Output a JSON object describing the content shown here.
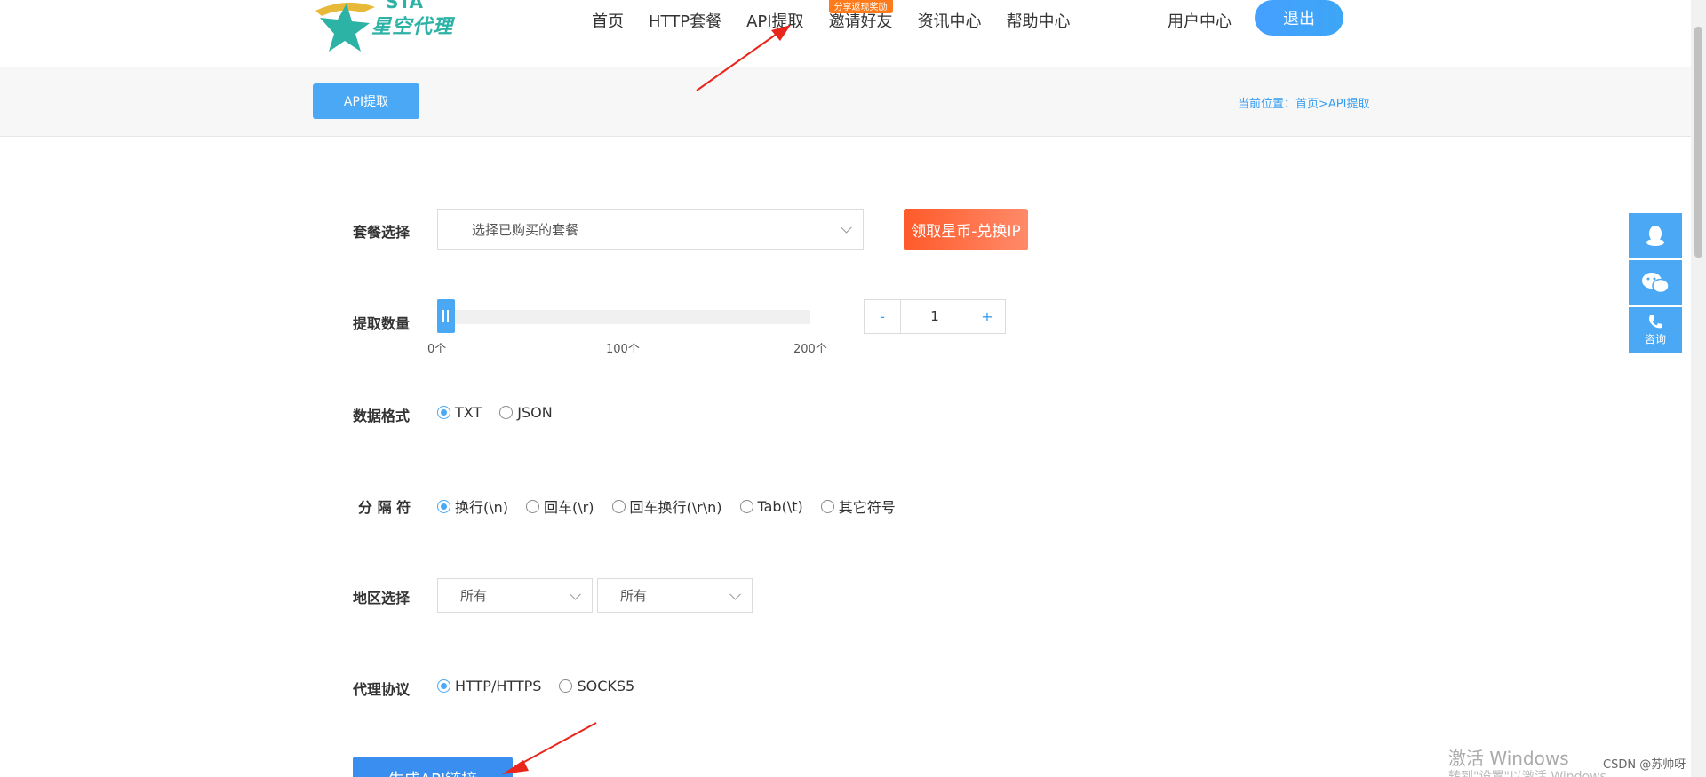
{
  "header": {
    "logo_top": "STA",
    "logo_text": "星空代理",
    "nav": [
      {
        "label": "首页"
      },
      {
        "label": "HTTP套餐"
      },
      {
        "label": "API提取"
      },
      {
        "label": "邀请好友",
        "badge": "分享返现奖励"
      },
      {
        "label": "资讯中心"
      },
      {
        "label": "帮助中心"
      }
    ],
    "user_center": "用户中心",
    "logout": "退出"
  },
  "subbar": {
    "tab": "API提取",
    "breadcrumb": "当前位置：首页>API提取"
  },
  "form": {
    "package": {
      "label": "套餐选择",
      "placeholder": "选择已购买的套餐",
      "exchange_button": "领取星币-兑换IP"
    },
    "quantity": {
      "label": "提取数量",
      "ticks": [
        "0个",
        "100个",
        "200个"
      ],
      "value": "1",
      "minus": "-",
      "plus": "+",
      "slider_fraction": 0.005
    },
    "format": {
      "label": "数据格式",
      "options": [
        {
          "label": "TXT",
          "checked": true
        },
        {
          "label": "JSON",
          "checked": false
        }
      ]
    },
    "separator": {
      "label": "分 隔 符",
      "options": [
        {
          "label": "换行(\\n)",
          "checked": true
        },
        {
          "label": "回车(\\r)",
          "checked": false
        },
        {
          "label": "回车换行(\\r\\n)",
          "checked": false
        },
        {
          "label": "Tab(\\t)",
          "checked": false
        },
        {
          "label": "其它符号",
          "checked": false
        }
      ]
    },
    "region": {
      "label": "地区选择",
      "province": "所有",
      "city": "所有"
    },
    "protocol": {
      "label": "代理协议",
      "options": [
        {
          "label": "HTTP/HTTPS",
          "checked": true
        },
        {
          "label": "SOCKS5",
          "checked": false
        }
      ]
    },
    "generate_button": "生成API链接"
  },
  "side": {
    "qq_icon": "qq-icon",
    "wechat_icon": "wechat-icon",
    "phone_label": "咨询"
  },
  "watermark": {
    "activate": "激活 Windows",
    "activate_sub": "转到\"设置\"以激活 Windows。",
    "csdn": "CSDN @苏帅呀"
  },
  "colors": {
    "accent": "#4aa8f5",
    "exchange": "#ff5a2a",
    "arrow": "#e8261c"
  }
}
